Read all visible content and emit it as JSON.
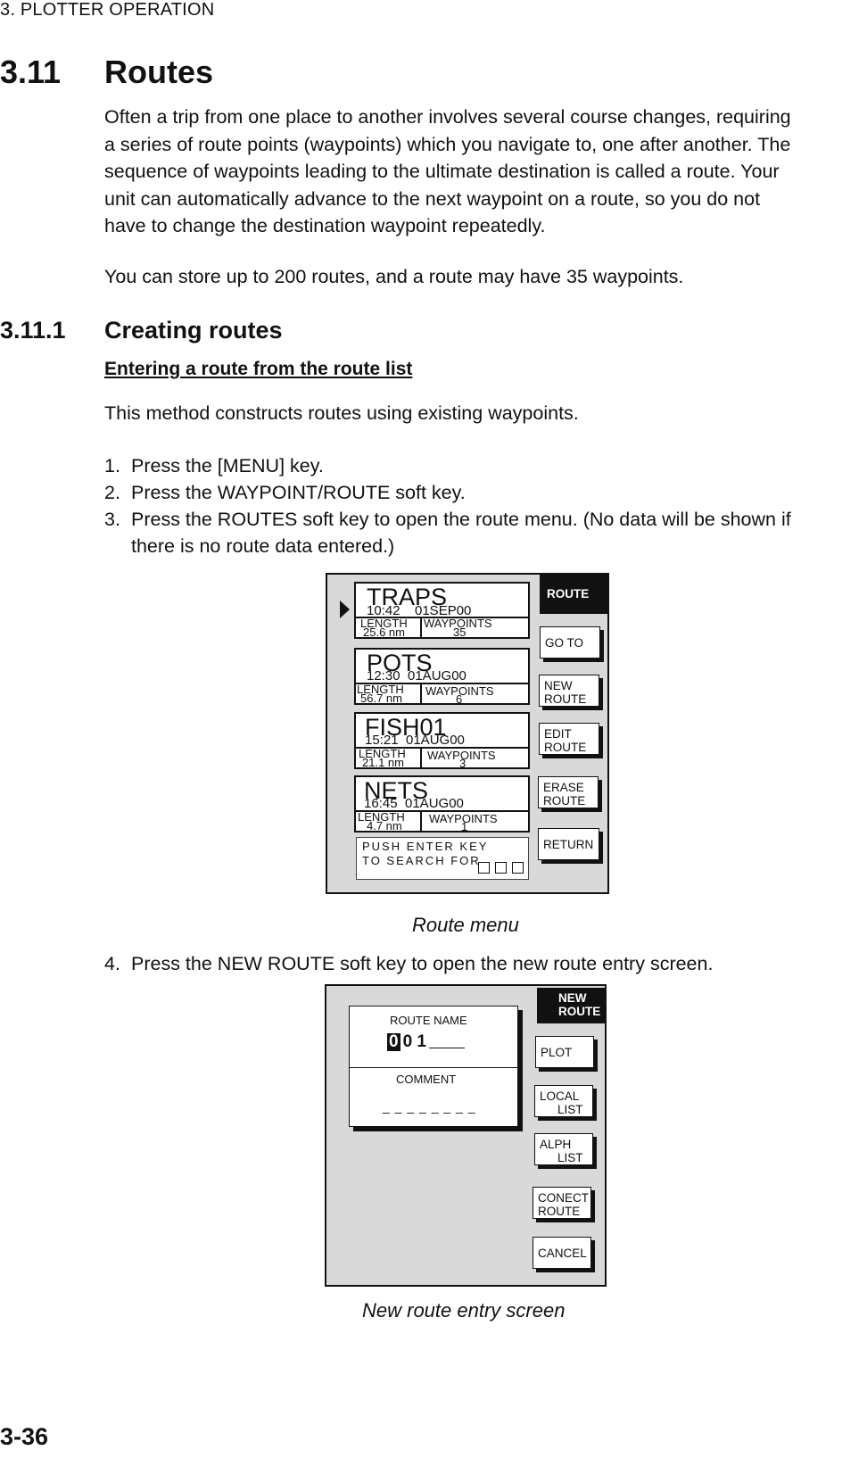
{
  "page": {
    "running_header": "3. PLOTTER OPERATION",
    "page_number": "3-36"
  },
  "section": {
    "number": "3.11",
    "title": "Routes",
    "intro_lines": [
      "Often a trip from one place to another involves several course changes, requiring",
      "a series of route points (waypoints) which you navigate to, one after another. The",
      "sequence of waypoints leading to the ultimate destination is called a route. Your",
      "unit can automatically advance to the next waypoint on a route, so you do not",
      "have to change the destination waypoint repeatedly."
    ],
    "capacity": "You can store up to 200 routes, and a route may have 35 waypoints."
  },
  "subsection": {
    "number": "3.11.1",
    "title": "Creating routes",
    "procedure_title": "Entering a route from the route list",
    "procedure_intro": "This method constructs routes using existing waypoints.",
    "steps": [
      {
        "num": "1.",
        "text": "Press the [MENU] key."
      },
      {
        "num": "2.",
        "text": "Press the WAYPOINT/ROUTE soft key."
      },
      {
        "num": "3.",
        "text": "Press the ROUTES soft key to open the route menu. (No data will be shown if",
        "text2": "there is no route data entered.)"
      },
      {
        "num": "4.",
        "text": "Press the NEW ROUTE soft key to open the new route entry screen."
      }
    ]
  },
  "route_menu": {
    "caption": "Route menu",
    "header": "ROUTE",
    "length_label": "LENGTH",
    "waypoints_label": "WAYPOINTS",
    "routes": [
      {
        "name": "TRAPS",
        "time": "10:42",
        "date": "01SEP00",
        "length": "25.6 nm",
        "waypoints": "35",
        "selected": true
      },
      {
        "name": "POTS",
        "time": "12:30",
        "date": "01AUG00",
        "length": "56.7 nm",
        "waypoints": "6"
      },
      {
        "name": "FISH01",
        "time": "15:21",
        "date": "01AUG00",
        "length": "21.1 nm",
        "waypoints": "3"
      },
      {
        "name": "NETS",
        "time": "16:45",
        "date": "01AUG00",
        "length": "4.7 nm",
        "waypoints": "1"
      }
    ],
    "search_prompt_line1": "PUSH ENTER KEY",
    "search_prompt_line2": "TO SEARCH FOR",
    "softkeys": [
      {
        "line1": "GO TO",
        "line2": ""
      },
      {
        "line1": "NEW",
        "line2": "ROUTE"
      },
      {
        "line1": "EDIT",
        "line2": "ROUTE"
      },
      {
        "line1": "ERASE",
        "line2": "ROUTE"
      },
      {
        "line1": "RETURN",
        "line2": ""
      }
    ]
  },
  "new_route_screen": {
    "caption": "New route entry screen",
    "header_line1": "NEW",
    "header_line2": "ROUTE",
    "route_name_label": "ROUTE NAME",
    "route_name_cursor_char": "0",
    "route_name_rest": "0 1",
    "comment_label": "COMMENT",
    "comment_placeholder": "_ _ _ _ _ _ _ _",
    "softkeys": [
      {
        "line1": "PLOT",
        "line2": ""
      },
      {
        "line1": "LOCAL",
        "line2": "LIST"
      },
      {
        "line1": "ALPH",
        "line2": "LIST"
      },
      {
        "line1": "CONECT",
        "line2": "ROUTE"
      },
      {
        "line1": "CANCEL",
        "line2": ""
      }
    ]
  }
}
